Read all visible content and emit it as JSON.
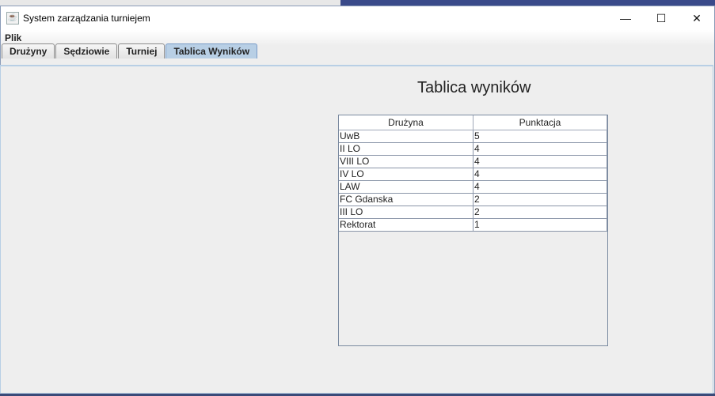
{
  "window": {
    "title": "System zarządzania turniejem",
    "minimize": "—",
    "maximize": "☐",
    "close": "✕"
  },
  "menu": {
    "items": [
      {
        "label": "Plik"
      }
    ]
  },
  "tabs": [
    {
      "label": "Drużyny"
    },
    {
      "label": "Sędziowie"
    },
    {
      "label": "Turniej"
    },
    {
      "label": "Tablica Wyników",
      "active": true
    }
  ],
  "scoreboard": {
    "heading": "Tablica wyników",
    "columns": [
      "Drużyna",
      "Punktacja"
    ],
    "rows": [
      [
        "UwB",
        "5"
      ],
      [
        "II LO",
        "4"
      ],
      [
        "VIII LO",
        "4"
      ],
      [
        "IV LO",
        "4"
      ],
      [
        "LAW",
        "4"
      ],
      [
        "FC Gdanska",
        "2"
      ],
      [
        "III LO",
        "2"
      ],
      [
        "Rektorat",
        "1"
      ]
    ]
  }
}
